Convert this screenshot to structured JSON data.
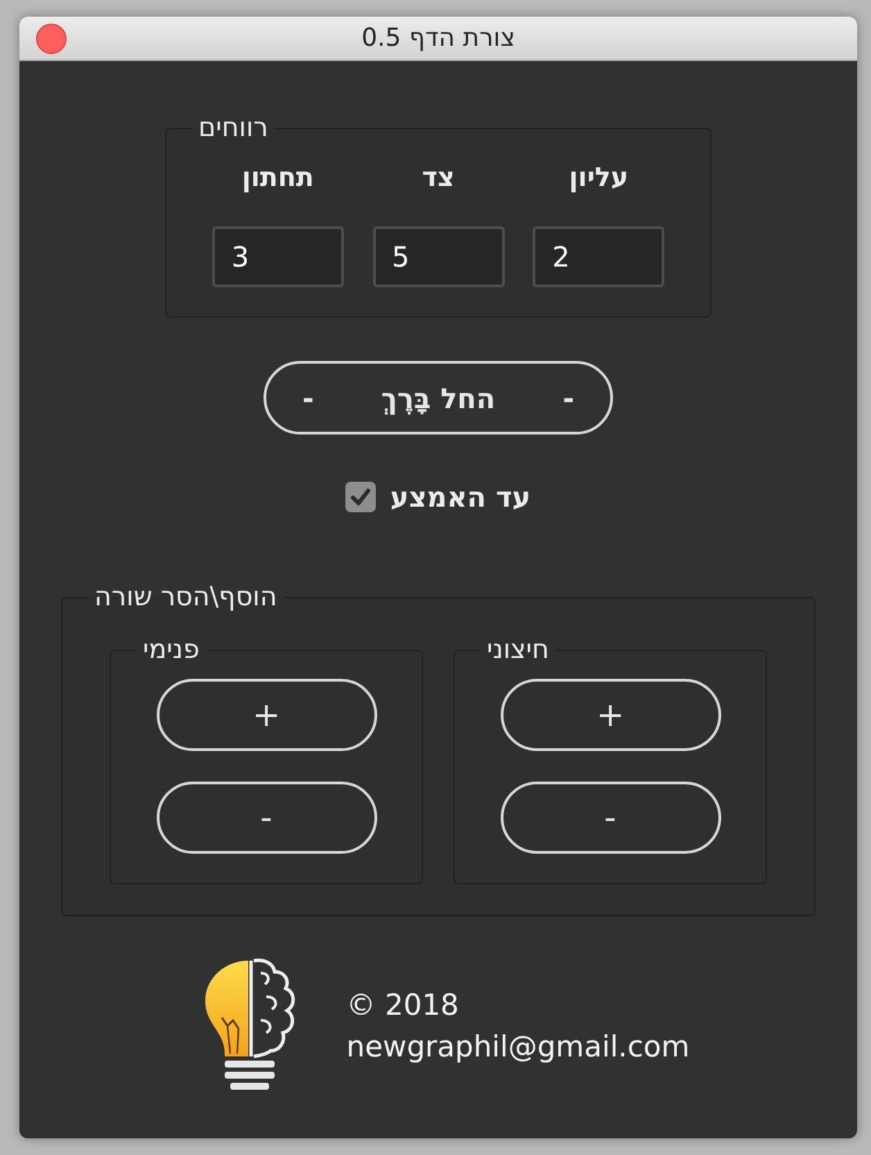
{
  "window": {
    "title": "צורת הדף 0.5"
  },
  "margins": {
    "title": "רווחים",
    "fields": [
      {
        "label": "עליון",
        "value": "2"
      },
      {
        "label": "צד",
        "value": "5"
      },
      {
        "label": "תחתון",
        "value": "3"
      }
    ]
  },
  "apply_button": {
    "label": "החל בָּרֶךְ",
    "side_marks": [
      "-",
      "-"
    ]
  },
  "checkbox": {
    "label": "עד האמצע",
    "checked": true
  },
  "rows": {
    "title": "הוסף\\הסר שורה",
    "groups": [
      {
        "title": "חיצוני",
        "buttons": [
          "+",
          "-"
        ]
      },
      {
        "title": "פנימי",
        "buttons": [
          "+",
          "-"
        ]
      }
    ]
  },
  "footer": {
    "copyright": "© 2018",
    "email": "newgraphil@gmail.com"
  }
}
